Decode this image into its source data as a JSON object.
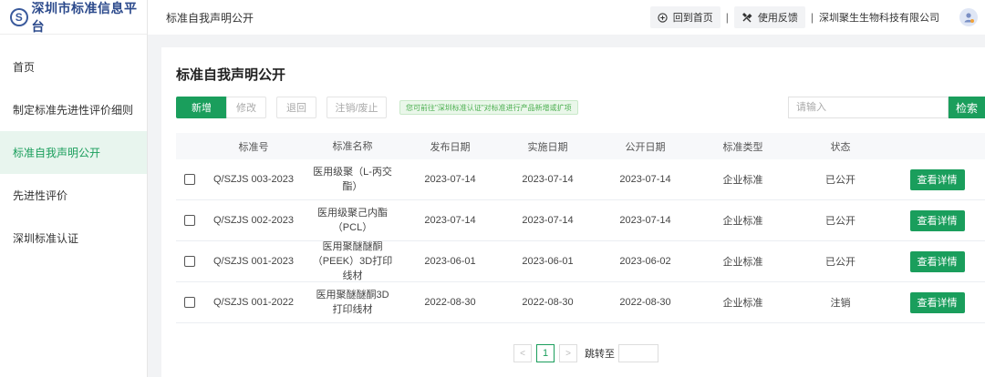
{
  "sidebar": {
    "logo_mark": "S",
    "logo_text": "深圳市标准信息平台",
    "items": [
      {
        "label": "首页"
      },
      {
        "label": "制定标准先进性评价细则"
      },
      {
        "label": "标准自我声明公开"
      },
      {
        "label": "先进性评价"
      },
      {
        "label": "深圳标准认证"
      }
    ]
  },
  "topbar": {
    "title": "标准自我声明公开",
    "home_label": "回到首页",
    "feedback_label": "使用反馈",
    "separator": "|",
    "company": "深圳聚生生物科技有限公司"
  },
  "main": {
    "title": "标准自我声明公开",
    "toolbar": {
      "add": "新增",
      "edit": "修改",
      "back": "退回",
      "cancel": "注销/废止",
      "hint": "您可前往\"深圳标准认证\"对标准进行产品新增或扩项"
    },
    "search": {
      "placeholder": "请输入",
      "button": "检索"
    },
    "table": {
      "headers": [
        "标准号",
        "标准名称",
        "发布日期",
        "实施日期",
        "公开日期",
        "标准类型",
        "状态"
      ],
      "rows": [
        {
          "code": "Q/SZJS 003-2023",
          "name": "医用级聚（L-丙交酯）",
          "issue": "2023-07-14",
          "impl": "2023-07-14",
          "publish": "2023-07-14",
          "type": "企业标准",
          "status": "已公开",
          "action": "查看详情"
        },
        {
          "code": "Q/SZJS 002-2023",
          "name": "医用级聚己内酯（PCL）",
          "issue": "2023-07-14",
          "impl": "2023-07-14",
          "publish": "2023-07-14",
          "type": "企业标准",
          "status": "已公开",
          "action": "查看详情"
        },
        {
          "code": "Q/SZJS 001-2023",
          "name": "医用聚醚醚酮（PEEK）3D打印线材",
          "issue": "2023-06-01",
          "impl": "2023-06-01",
          "publish": "2023-06-02",
          "type": "企业标准",
          "status": "已公开",
          "action": "查看详情"
        },
        {
          "code": "Q/SZJS 001-2022",
          "name": "医用聚醚醚酮3D打印线材",
          "issue": "2022-08-30",
          "impl": "2022-08-30",
          "publish": "2022-08-30",
          "type": "企业标准",
          "status": "注销",
          "action": "查看详情"
        }
      ]
    },
    "pagination": {
      "prev": "<",
      "current": "1",
      "next": ">",
      "jump_label": "跳转至"
    }
  }
}
